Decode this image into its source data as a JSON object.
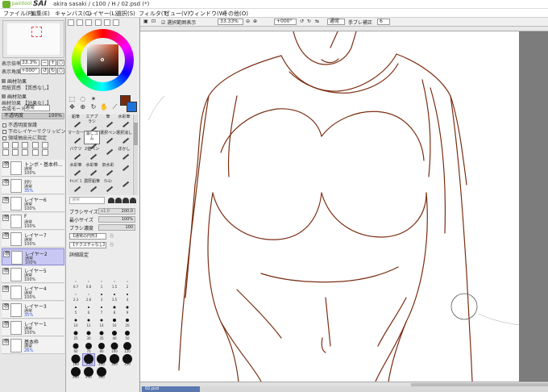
{
  "app": {
    "brand": "paintool",
    "name": "SAI",
    "document": "akira sasaki / c100 / H / 02.psd (*)"
  },
  "menu": [
    "ファイル(F)",
    "編集(E)",
    "キャンバス(C)",
    "レイヤー(L)",
    "選択(S)",
    "フィルタ(T)",
    "ビュー(V)",
    "ウィンドウ(W)",
    "その他(O)"
  ],
  "navigator": {
    "zoom_label": "表示倍率",
    "zoom_value": "33.3%",
    "angle_label": "表示角度",
    "angle_value": "+000°"
  },
  "layer_panel": {
    "paper_texture_label": "画材効果",
    "paper_texture_label2": "用紙質感",
    "paper_texture_value": "【質感なし】",
    "effect_label": "画材効果",
    "effect_value": "【効果なし】",
    "blend_label": "合成モード",
    "blend_value": "通常",
    "opacity_label": "不透明度",
    "opacity_value": "100%",
    "protect_opacity": "不透明度保護",
    "clip_lower": "下のレイヤーでクリッピング",
    "select_source": "領域抽出元に指定",
    "layers": [
      {
        "name": "トンボ・基本枠...",
        "mode": "通常",
        "opacity": "100%",
        "blue": false,
        "selected": false
      },
      {
        "name": "ﾀﾀﾘ",
        "mode": "通常",
        "opacity": "35%",
        "blue": true,
        "selected": false
      },
      {
        "name": "レイヤー6",
        "mode": "通常",
        "opacity": "100%",
        "blue": false,
        "selected": false
      },
      {
        "name": "F",
        "mode": "通常",
        "opacity": "100%",
        "blue": false,
        "selected": false
      },
      {
        "name": "レイヤー7",
        "mode": "通常",
        "opacity": "100%",
        "blue": false,
        "selected": false
      },
      {
        "name": "レイヤー2",
        "mode": "通常",
        "opacity": "100%",
        "blue": false,
        "selected": true
      },
      {
        "name": "レイヤー5",
        "mode": "通常",
        "opacity": "100%",
        "blue": false,
        "selected": false
      },
      {
        "name": "レイヤー4",
        "mode": "通常",
        "opacity": "100%",
        "blue": false,
        "selected": false
      },
      {
        "name": "レイヤー3",
        "mode": "通常",
        "opacity": "35%",
        "blue": true,
        "selected": false
      },
      {
        "name": "レイヤー1",
        "mode": "通常",
        "opacity": "100%",
        "blue": false,
        "selected": false
      },
      {
        "name": "基本枠",
        "mode": "通常",
        "opacity": "26%",
        "blue": true,
        "selected": false
      }
    ]
  },
  "color": {
    "foreground": "#7a2a0a",
    "background": "#1e73d8"
  },
  "tools": [
    {
      "label": "鉛筆",
      "selected": false
    },
    {
      "label": "エアブラシ",
      "selected": false
    },
    {
      "label": "筆",
      "selected": false
    },
    {
      "label": "水彩筆",
      "selected": false
    },
    {
      "label": "マーカー",
      "selected": false
    },
    {
      "label": "消しゴム",
      "selected": true
    },
    {
      "label": "選択ペン",
      "selected": false
    },
    {
      "label": "選択消し",
      "selected": false
    },
    {
      "label": "バケツ",
      "selected": false
    },
    {
      "label": "2値ペン",
      "selected": false
    },
    {
      "label": "",
      "selected": false
    },
    {
      "label": "ぼかし",
      "selected": false
    },
    {
      "label": "水彩筆",
      "selected": false
    },
    {
      "label": "水彩筆",
      "selected": false
    },
    {
      "label": "旧水彩",
      "selected": false
    },
    {
      "label": "",
      "selected": false
    },
    {
      "label": "ｷｬﾝﾊﾞｽ",
      "selected": false
    },
    {
      "label": "濃厚鉛筆",
      "selected": false
    },
    {
      "label": "ｸﾚﾖﾝ",
      "selected": false
    },
    {
      "label": "",
      "selected": false
    }
  ],
  "brush": {
    "mode_placeholder": "通常",
    "size_label": "ブラシサイズ",
    "size_mult": "x1.0",
    "size_value": "200.0",
    "min_label": "最小サイズ",
    "min_value": "100%",
    "density_label": "ブラシ濃度",
    "density_value": "100",
    "shape_value": "【通常の円形】",
    "texture_value": "【テクスチャなし】",
    "ghost1": "強",
    "ghost2": "強",
    "detail_label": "詳細設定",
    "sizes": [
      "0.7",
      "0.8",
      "1",
      "1.5",
      "2",
      "2.3",
      "2.6",
      "3",
      "3.5",
      "4",
      "5",
      "6",
      "7",
      "8",
      "9",
      "10",
      "12",
      "14",
      "16",
      "20",
      "25",
      "30",
      "35",
      "40",
      "50",
      "60",
      "70",
      "80",
      "100",
      "120",
      "160",
      "200",
      "250",
      "300",
      "350",
      "400",
      "450",
      "500"
    ],
    "selected_size": "200"
  },
  "canvas_toolbar": {
    "zoom_value": "33.33%",
    "angle_value": "+000°",
    "stabilizer_label": "手ブレ補正",
    "stabilizer_value": "6",
    "preview_label": "選択範囲表示",
    "blend_value": "通常"
  },
  "tabs": [
    "02.psd"
  ]
}
